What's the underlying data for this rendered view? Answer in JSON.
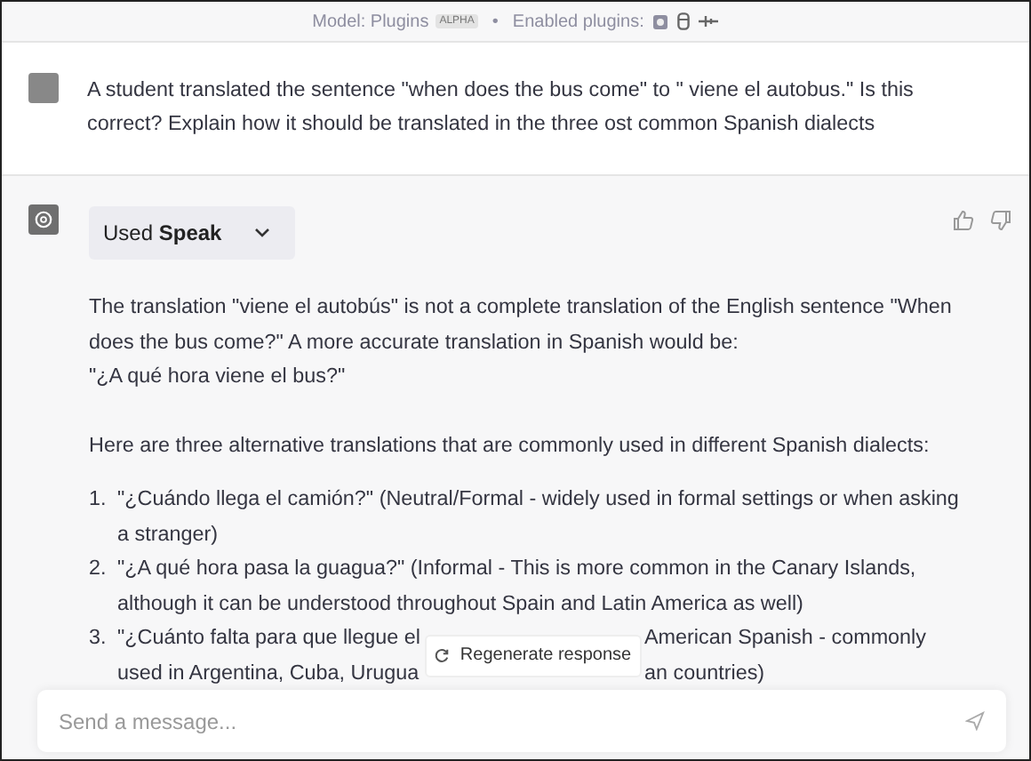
{
  "top_bar": {
    "model_label": "Model: Plugins",
    "model_badge": "ALPHA",
    "separator": "•",
    "plugins_label": "Enabled plugins:"
  },
  "user_message": {
    "text": "A student translated the sentence \"when does the bus come\" to \" viene el autobus.\" Is this correct? Explain how it should be translated in the three ost common Spanish dialects"
  },
  "assistant_message": {
    "plugin_button": {
      "prefix": "Used",
      "plugin": "Speak",
      "expanded": false
    },
    "paragraphs": [
      "The translation \"viene el autobús\" is not a complete translation of the English sentence \"When does the bus come?\" A more accurate translation in Spanish would be:",
      "\"¿A qué hora viene el bus?\""
    ],
    "intro": "Here are three alternative translations that are commonly used in different Spanish dialects:",
    "list": [
      {
        "number": "1.",
        "text": "\"¿Cuándo llega el camión?\" (Neutral/Formal - widely used in formal settings or when asking a stranger)"
      },
      {
        "number": "2.",
        "text": "\"¿A qué hora pasa la guagua?\" (Informal - This is more common in the Canary Islands, although it can be understood throughout Spain and Latin America as well)"
      },
      {
        "number": "3.",
        "lines": [
          [
            "\"¿Cuánto falta para que llegue el",
            "American Spanish - commonly"
          ],
          [
            "used in Argentina, Cuba, Urugua",
            "an countries)"
          ]
        ]
      }
    ]
  },
  "regenerate_button": {
    "label": "Regenerate response"
  },
  "composer": {
    "placeholder": "Send a message..."
  }
}
